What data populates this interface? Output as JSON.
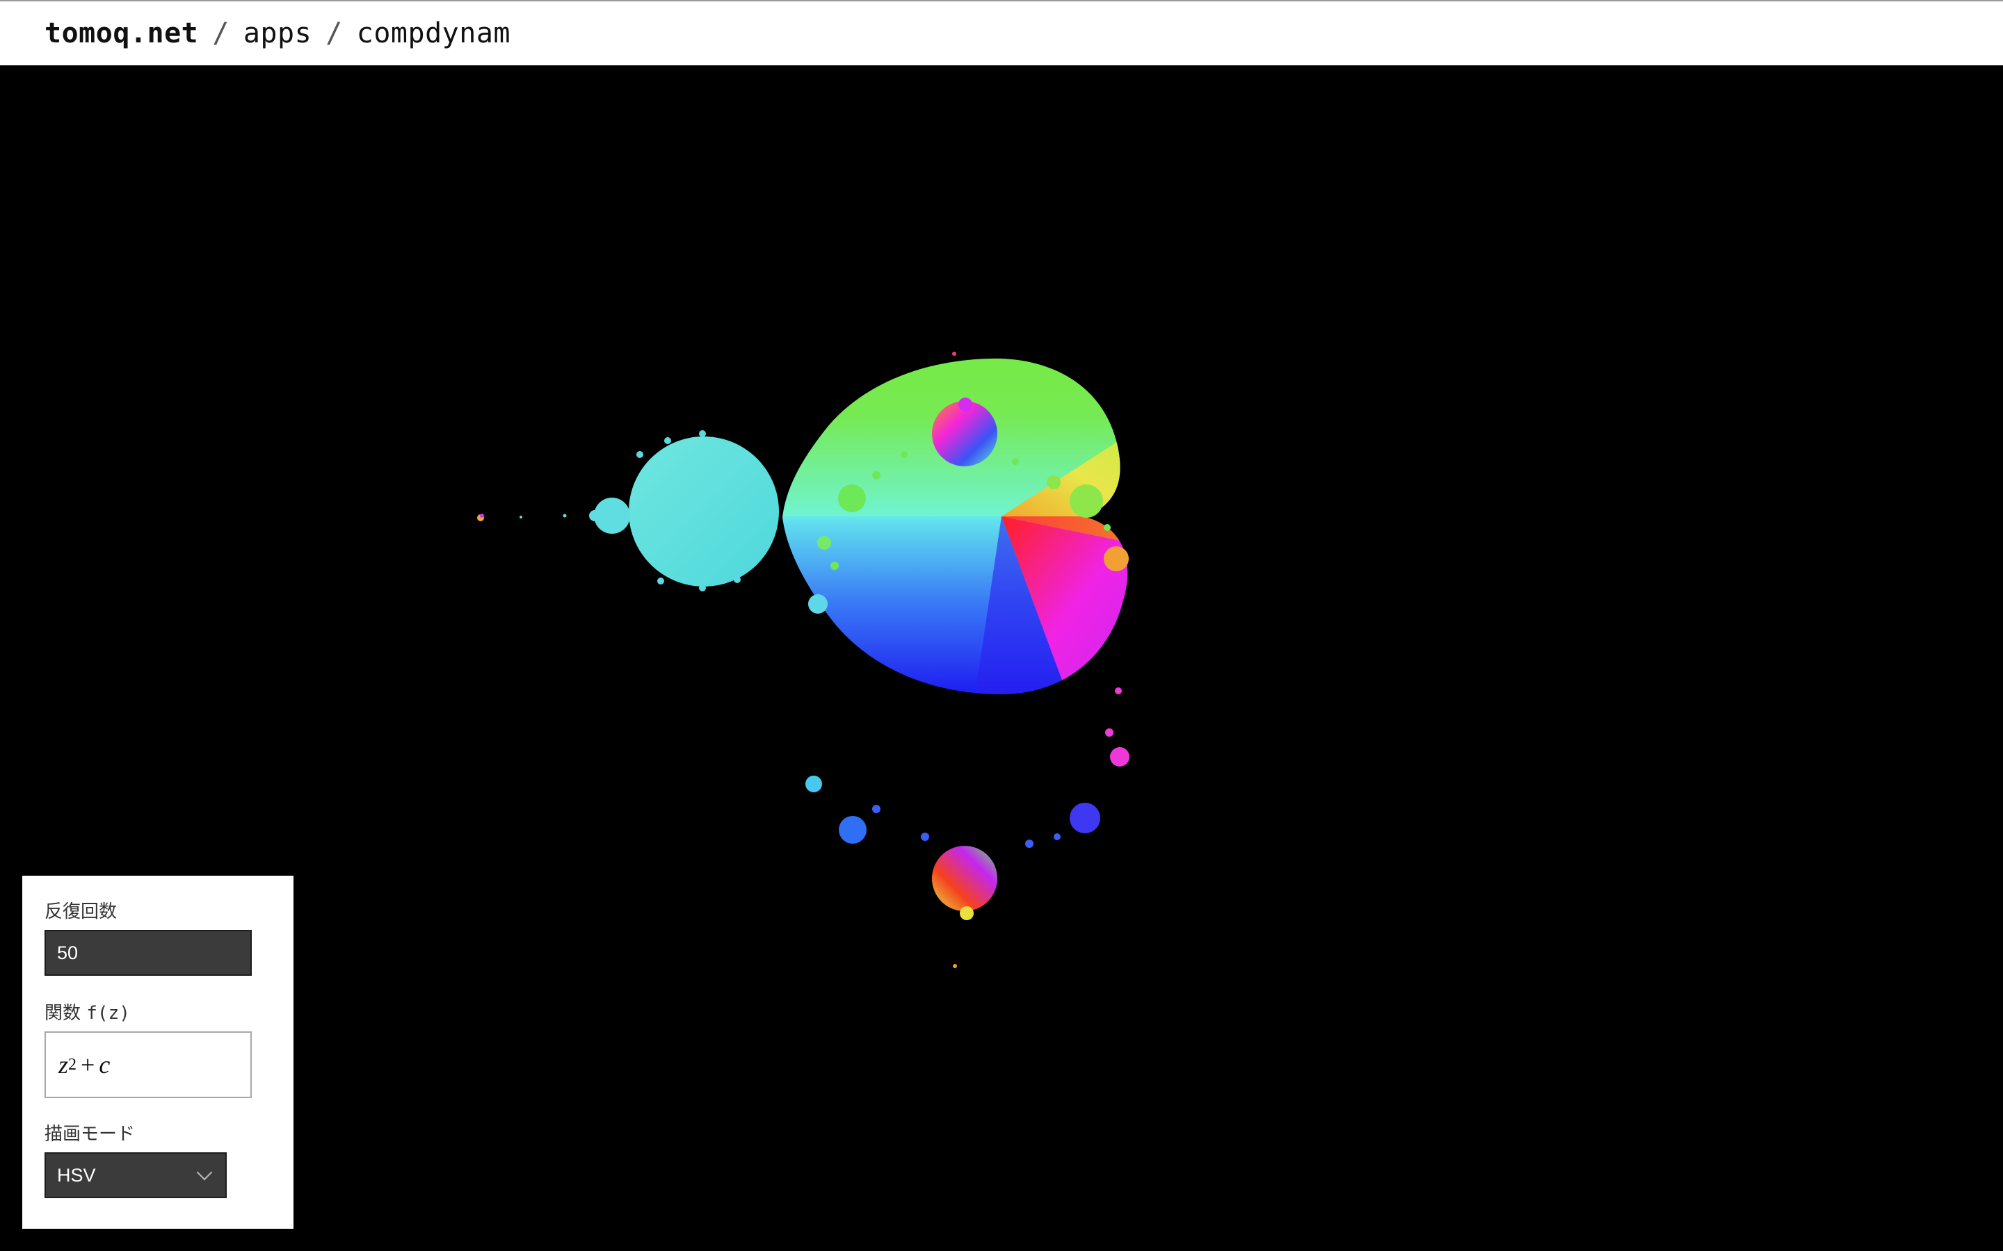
{
  "breadcrumb": {
    "site": "tomoq.net",
    "section": "apps",
    "page": "compdynam",
    "separator": "/"
  },
  "controls": {
    "iterations_label": "反復回数",
    "iterations_value": "50",
    "function_label_jp": "関数",
    "function_label_sym": "f(z)",
    "function_expr": {
      "base": "z",
      "exponent": "2",
      "operator": "+",
      "constant": "c"
    },
    "mode_label": "描画モード",
    "mode_value": "HSV"
  },
  "icons": {
    "mode_dropdown": "chevron-down-icon"
  },
  "colors": {
    "background": "#000000",
    "input_bg": "#3b3b3b",
    "panel_bg": "#ffffff"
  }
}
